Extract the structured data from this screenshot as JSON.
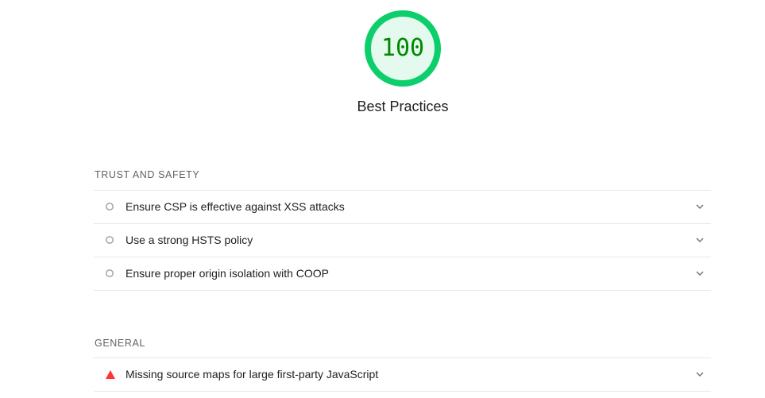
{
  "category": {
    "score": "100",
    "score_fraction": 1.0,
    "title": "Best Practices",
    "color": "#0cce6b",
    "fill_color": "#e5faef",
    "text_color": "#008800"
  },
  "groups": [
    {
      "title": "TRUST AND SAFETY",
      "audits": [
        {
          "label": "Ensure CSP is effective against XSS attacks",
          "icon": "informative-circle-icon"
        },
        {
          "label": "Use a strong HSTS policy",
          "icon": "informative-circle-icon"
        },
        {
          "label": "Ensure proper origin isolation with COOP",
          "icon": "informative-circle-icon"
        }
      ]
    },
    {
      "title": "GENERAL",
      "audits": [
        {
          "label": "Missing source maps for large first-party JavaScript",
          "icon": "fail-triangle-icon"
        }
      ]
    }
  ],
  "colors": {
    "fail": "#ff3333",
    "informative": "#9e9e9e",
    "divider": "#e8e8e8"
  }
}
